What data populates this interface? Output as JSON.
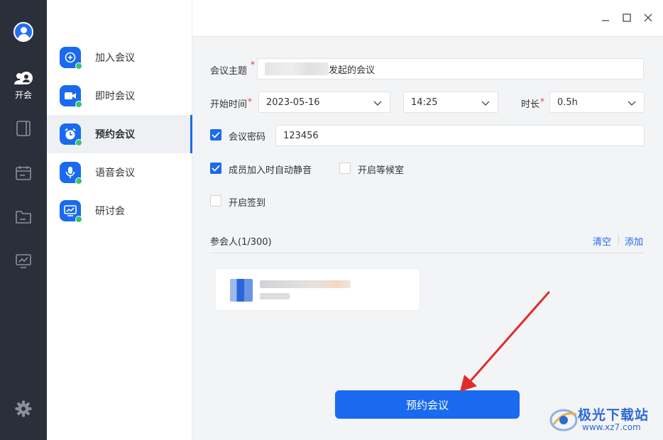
{
  "rail": {
    "items": [
      {
        "name": "meeting",
        "label": "开会",
        "icon": "users-icon"
      },
      {
        "name": "docs",
        "icon": "tablet-icon"
      },
      {
        "name": "calendar",
        "icon": "calendar-icon"
      },
      {
        "name": "files",
        "icon": "folder-icon"
      },
      {
        "name": "screen",
        "icon": "monitor-icon"
      }
    ],
    "settings_icon": "gear-icon"
  },
  "subnav": {
    "items": [
      {
        "label": "加入会议",
        "icon": "plus-circle-icon"
      },
      {
        "label": "即时会议",
        "icon": "video-camera-icon"
      },
      {
        "label": "预约会议",
        "icon": "alarm-clock-icon",
        "active": true
      },
      {
        "label": "语音会议",
        "icon": "microphone-icon"
      },
      {
        "label": "研讨会",
        "icon": "presentation-icon"
      }
    ]
  },
  "window": {
    "minimize": "minimize-icon",
    "maximize": "maximize-icon",
    "close": "close-icon"
  },
  "form": {
    "topic_label": "会议主题",
    "topic_suffix": "发起的会议",
    "start_label": "开始时间",
    "start_date": "2023-05-16",
    "start_time": "14:25",
    "duration_label": "时长",
    "duration_value": "0.5h",
    "password_label": "会议密码",
    "password_value": "123456",
    "password_checked": true,
    "mute_label": "成员加入时自动静音",
    "mute_checked": true,
    "waiting_label": "开启等候室",
    "waiting_checked": false,
    "signin_label": "开启签到",
    "signin_checked": false
  },
  "participants": {
    "label": "参会人(1/300)",
    "clear": "清空",
    "add": "添加"
  },
  "submit_label": "预约会议",
  "watermark": {
    "title": "极光下载站",
    "url": "www.xz7.com"
  },
  "colors": {
    "accent": "#1a6af0",
    "rail": "#2b2f3a",
    "arrow": "#e02b2b",
    "badge": "#3ac36a"
  }
}
